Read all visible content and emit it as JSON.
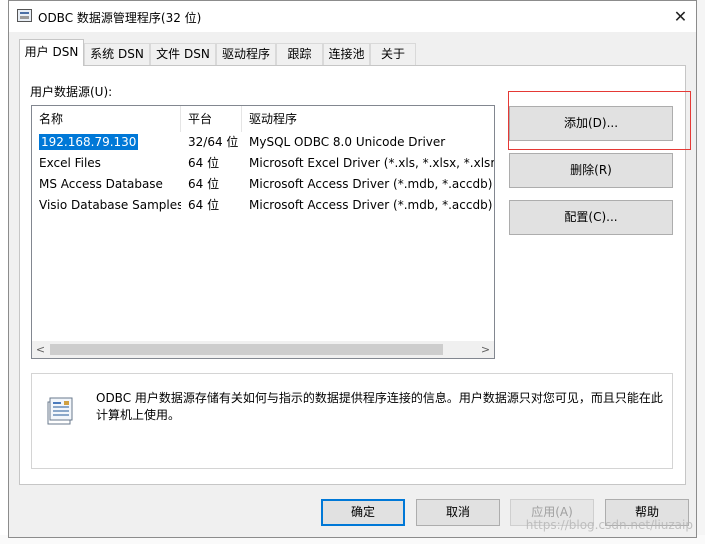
{
  "window": {
    "title": "ODBC 数据源管理程序(32 位)",
    "close_glyph": "✕"
  },
  "tabs": [
    "用户 DSN",
    "系统 DSN",
    "文件 DSN",
    "驱动程序",
    "跟踪",
    "连接池",
    "关于"
  ],
  "section_label": "用户数据源(U):",
  "columns": [
    "名称",
    "平台",
    "驱动程序"
  ],
  "rows": [
    {
      "name": "192.168.79.130",
      "platform": "32/64 位",
      "driver": "MySQL ODBC 8.0 Unicode Driver",
      "selected": true
    },
    {
      "name": "Excel Files",
      "platform": "64 位",
      "driver": "Microsoft Excel Driver (*.xls, *.xlsx, *.xlsm, *"
    },
    {
      "name": "MS Access Database",
      "platform": "64 位",
      "driver": "Microsoft Access Driver (*.mdb, *.accdb)"
    },
    {
      "name": "Visio Database Samples",
      "platform": "64 位",
      "driver": "Microsoft Access Driver (*.mdb, *.accdb)"
    }
  ],
  "side_buttons": {
    "add": "添加(D)...",
    "remove": "删除(R)",
    "configure": "配置(C)..."
  },
  "info_text": "ODBC 用户数据源存储有关如何与指示的数据提供程序连接的信息。用户数据源只对您可见，而且只能在此计算机上使用。",
  "bottom_buttons": {
    "ok": "确定",
    "cancel": "取消",
    "apply": "应用(A)",
    "help": "帮助"
  },
  "watermark": "https://blog.csdn.net/liuzaip",
  "colors": {
    "selection": "#0078d7",
    "highlight": "#e53935"
  }
}
